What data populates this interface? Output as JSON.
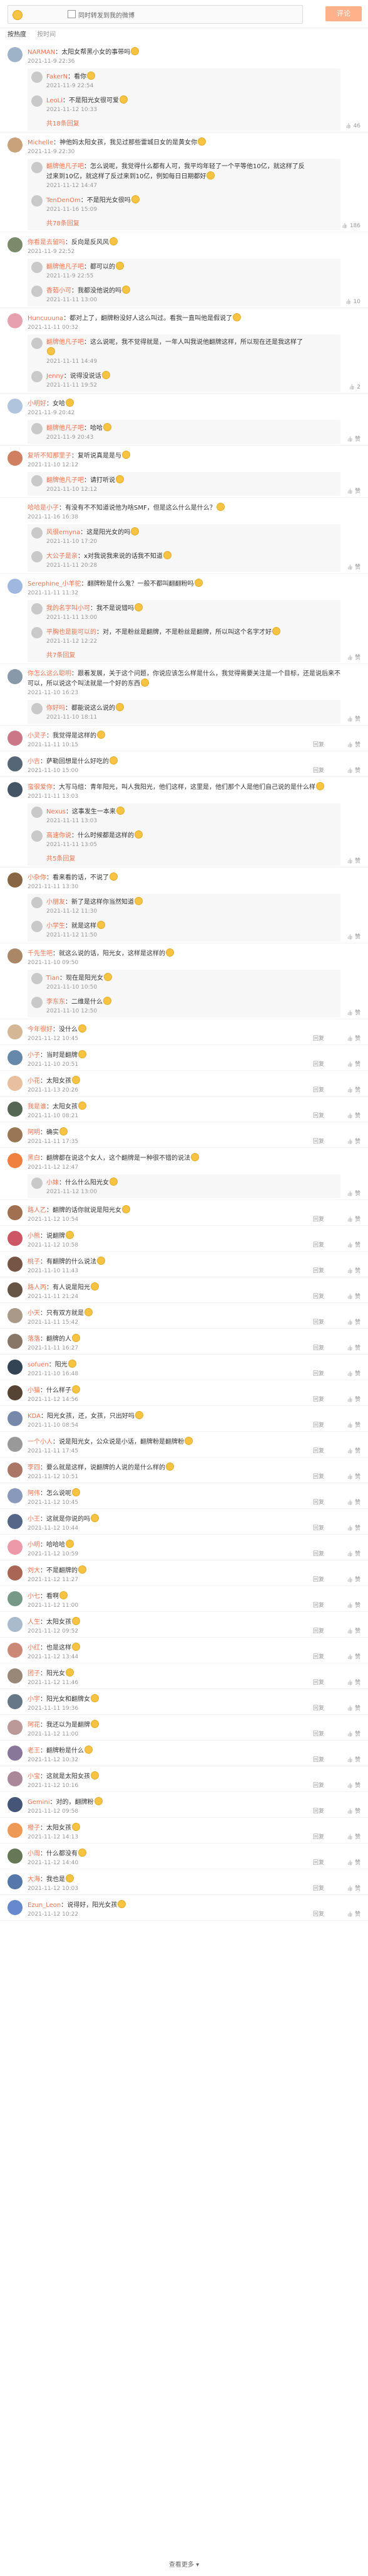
{
  "composer": {
    "placeholder": "",
    "sync_label": "同时转发到我的微博",
    "submit_label": "评论"
  },
  "sort": {
    "hot": "按热度",
    "time": "按时间"
  },
  "colors": {
    "accent": "#eb7350",
    "submit": "#ffb28a"
  },
  "comments": [
    {
      "user": "NARMAN",
      "text": "：太阳女帮黑小女的事带吗",
      "time": "2021-11-9 22:36",
      "likes": "46",
      "av": "#9fb3c8",
      "replies": [
        {
          "user": "FakerN",
          "text": "：看你",
          "time": "2021-11-9 22:54"
        },
        {
          "user": "LeoLi",
          "text": "：不是阳光女很可爱",
          "time": "2021-11-12 10:33"
        }
      ],
      "more": "共18条回复"
    },
    {
      "user": "Michelle",
      "text": "：神他妈太阳女孩，我见过那些雷城日女的是黄女你",
      "time": "2021-11-9 22:30",
      "likes": "186",
      "av": "#c8a27a",
      "replies": [
        {
          "user": "翻牌他凡子吧",
          "text": "：怎么说呢，我觉得什么都有人可，我平均年轻了一个平等他10亿，就这样了反过来到10亿，就这样了反过来到10亿，例如每日日期都好",
          "time": "2021-11-12 14:47"
        },
        {
          "user": "TenDenOm",
          "text": "：不是阳光女很吗",
          "time": "2021-11-16 15:09"
        }
      ],
      "more": "共78条回复"
    },
    {
      "user": "你看是去留吗",
      "text": "：反向是反风风",
      "time": "2021-11-9 22:52",
      "likes": "10",
      "av": "#7a8a6b",
      "replies": [
        {
          "user": "翻牌他凡子吧",
          "text": "：都可以的",
          "time": "2021-11-9 22:55"
        },
        {
          "user": "香茹小可",
          "text": "：我都没他说的吗",
          "time": "2021-11-11 13:00"
        }
      ],
      "more": ""
    },
    {
      "user": "Huncuuuna",
      "text": "：都对上了，翻牌粉没好人这么叫过。看我一直叫他是假说了",
      "time": "2021-11-11 00:32",
      "likes": "2",
      "av": "#e6a0b0",
      "replies": [
        {
          "user": "翻牌他凡子吧",
          "text": "：这么说呢，我不觉得就是，一年人叫我说他翻牌这样，所以现在还是我这样了",
          "time": "2021-11-11 14:49"
        },
        {
          "user": "Jenny",
          "text": "：说得没说话",
          "time": "2021-11-11 19:52"
        }
      ],
      "more": ""
    },
    {
      "user": "小明好",
      "text": "：女哈",
      "time": "2021-11-9 20:42",
      "likes": "",
      "av": "#b0c4de",
      "replies": [
        {
          "user": "翻牌他凡子吧",
          "text": "：哈哈",
          "time": "2021-11-9 20:43"
        }
      ],
      "more": ""
    },
    {
      "user": "复听不知那里子",
      "text": "：复听说真是是与",
      "time": "2021-11-10 12:12",
      "likes": "",
      "av": "#d08060",
      "replies": [
        {
          "user": "翻牌他凡子吧",
          "text": "：请打听说",
          "time": "2021-11-10 12:12"
        }
      ],
      "more": ""
    },
    {
      "user": "哈哈是小子",
      "text": "：有没有不不知道说他为啥SMF，但是这么什么是什么？",
      "time": "2021-11-16 16:38",
      "likes": "",
      "av": "#ffffff",
      "replies": [
        {
          "user": "风很emyna",
          "text": "：这是阳光女的吗",
          "time": "2021-11-10 17:20"
        },
        {
          "user": "大公子是亲",
          "text": "：x对我说我来说的话我不知道",
          "time": "2021-11-11 20:28"
        }
      ],
      "more": ""
    },
    {
      "user": "Serephine_小羊驼",
      "text": "：翻牌粉是什么鬼？一般不都叫翻翻粉吗",
      "time": "2021-11-11 11:32",
      "likes": "",
      "av": "#a0b8e0",
      "replies": [
        {
          "user": "我的名字叫小可",
          "text": "：我不是说错吗",
          "time": "2021-11-11 13:00"
        },
        {
          "user": "平胸也是能可以的",
          "text": "：对，不是粉丝是翻牌，不是粉丝是翻牌，所以叫这个名字才好",
          "time": "2021-11-12 12:22"
        }
      ],
      "more": "共7条回复"
    },
    {
      "user": "你怎么这么聪明",
      "text": "：跟着发展，关于这个问题，你说应该怎么样是什么，我觉得需要关注是一个目标，还是说后来不可以，所以说这个叫法就是一个好的东西",
      "time": "2021-11-10 16:23",
      "likes": "",
      "av": "#8899aa",
      "replies": [
        {
          "user": "你好吗",
          "text": "：都能说这么说的",
          "time": "2021-11-10 18:11"
        }
      ],
      "more": ""
    },
    {
      "user": "小灵子",
      "text": "：我觉得是这样的",
      "time": "2021-11-11 10:15",
      "likes": "",
      "av": "#cc7788",
      "replies": [],
      "more": ""
    },
    {
      "user": "小吉",
      "text": "：萨勒回想是什么好吃的",
      "time": "2021-11-10 15:00",
      "likes": "",
      "av": "#556677",
      "replies": [],
      "more": ""
    },
    {
      "user": "蛮很爱你",
      "text": "：大写马组：青年阳光，叫人我阳光，他们这样，这里是，他们那个人是他们自己说的是什么样",
      "time": "2021-11-11 13:03",
      "likes": "",
      "av": "#445566",
      "replies": [
        {
          "user": "Nexus",
          "text": "：这事发生一本来",
          "time": "2021-11-11 13:03"
        },
        {
          "user": "高速你说",
          "text": "：什么时候都是这样的",
          "time": "2021-11-11 13:05"
        }
      ],
      "more": "共5条回复"
    },
    {
      "user": "小杂你",
      "text": "：看来看的话，不说了",
      "time": "2021-11-11 13:30",
      "likes": "",
      "av": "#886644",
      "replies": [
        {
          "user": "小朋友",
          "text": "：新了是这样你当然知道",
          "time": "2021-11-12 11:30"
        },
        {
          "user": "小学生",
          "text": "：就是这样",
          "time": "2021-11-12 11:50"
        }
      ],
      "more": ""
    },
    {
      "user": "千先生吧",
      "text": "：就这么说的话，阳光女，这样是这样的",
      "time": "2021-11-10 09:50",
      "likes": "",
      "av": "#aa8866",
      "replies": [
        {
          "user": "Tian",
          "text": "：现在是阳光女",
          "time": "2021-11-10 10:50"
        },
        {
          "user": "李东东",
          "text": "：二维是什么",
          "time": "2021-11-10 12:50"
        }
      ],
      "more": ""
    },
    {
      "user": "今年很好",
      "text": "：没什么",
      "time": "2021-11-12 10:45",
      "likes": "",
      "av": "#d4b896",
      "replies": [],
      "more": ""
    },
    {
      "user": "小子",
      "text": "：当时是翻牌",
      "time": "2021-11-10 20:51",
      "likes": "",
      "av": "#6688aa",
      "replies": [],
      "more": ""
    },
    {
      "user": "小花",
      "text": "：太阳女孩",
      "time": "2021-11-13 20:26",
      "likes": "",
      "av": "#e8c0a0",
      "replies": [],
      "more": ""
    },
    {
      "user": "我是谁",
      "text": "：太阳女孩",
      "time": "2021-11-10 08:21",
      "likes": "",
      "av": "#556655",
      "replies": [],
      "more": ""
    },
    {
      "user": "阿明",
      "text": "：确实",
      "time": "2021-11-11 17:35",
      "likes": "",
      "av": "#997755",
      "replies": [],
      "more": ""
    },
    {
      "user": "黑白",
      "text": "：翻牌都在说这个女人，这个翻牌是一种很不错的说法",
      "time": "2021-11-12 12:47",
      "likes": "",
      "av": "#f08040",
      "replies": [
        {
          "user": "小妹",
          "text": "：什么什么阳光女",
          "time": "2021-11-12 13:00"
        }
      ],
      "more": ""
    },
    {
      "user": "路人乙",
      "text": "：翻牌的话你就说是阳光女",
      "time": "2021-11-12 10:54",
      "likes": "",
      "av": "#a07050",
      "replies": [],
      "more": ""
    },
    {
      "user": "小熊",
      "text": "：说翻牌",
      "time": "2021-11-12 10:58",
      "likes": "",
      "av": "#cc5566",
      "replies": [],
      "more": ""
    },
    {
      "user": "桃子",
      "text": "：有翻牌的什么说法",
      "time": "2021-11-10 11:43",
      "likes": "",
      "av": "#775544",
      "replies": [],
      "more": ""
    },
    {
      "user": "路人丙",
      "text": "：有人说是阳光",
      "time": "2021-11-11 21:24",
      "likes": "",
      "av": "#665544",
      "replies": [],
      "more": ""
    },
    {
      "user": "小天",
      "text": "：只有双方就是",
      "time": "2021-11-11 15:42",
      "likes": "",
      "av": "#aa9988",
      "replies": [],
      "more": ""
    },
    {
      "user": "落落",
      "text": "：翻牌的人",
      "time": "2021-11-11 16:27",
      "likes": "",
      "av": "#887766",
      "replies": [],
      "more": ""
    },
    {
      "user": "sofuen",
      "text": "：阳光",
      "time": "2021-11-10 16:48",
      "likes": "",
      "av": "#334455",
      "replies": [],
      "more": ""
    },
    {
      "user": "小猫",
      "text": "：什么样子",
      "time": "2021-11-12 14:56",
      "likes": "",
      "av": "#554433",
      "replies": [],
      "more": ""
    },
    {
      "user": "KDA",
      "text": "：阳光女孩，还，女孩，只出好吗",
      "time": "2021-11-10 08:54",
      "likes": "",
      "av": "#7788aa",
      "replies": [],
      "more": ""
    },
    {
      "user": "一个小人",
      "text": "：说是阳光女，公众说是小话，翻牌粉是翻牌粉",
      "time": "2021-11-11 17:45",
      "likes": "",
      "av": "#999999",
      "replies": [],
      "more": ""
    },
    {
      "user": "李四",
      "text": "：要么就是这样，说翻牌的人说的是什么样的",
      "time": "2021-11-12 10:51",
      "likes": "",
      "av": "#aa7766",
      "replies": [],
      "more": ""
    },
    {
      "user": "阿伟",
      "text": "：怎么说呢",
      "time": "2021-11-12 10:45",
      "likes": "",
      "av": "#8899bb",
      "replies": [],
      "more": ""
    },
    {
      "user": "小王",
      "text": "：这就是你说的吗",
      "time": "2021-11-12 10:44",
      "likes": "",
      "av": "#556688",
      "replies": [],
      "more": ""
    },
    {
      "user": "小明",
      "text": "：哈哈哈",
      "time": "2021-11-12 10:59",
      "likes": "",
      "av": "#ee99aa",
      "replies": [],
      "more": ""
    },
    {
      "user": "刘大",
      "text": "：不是翻牌的",
      "time": "2021-11-12 11:27",
      "likes": "",
      "av": "#aa6655",
      "replies": [],
      "more": ""
    },
    {
      "user": "小七",
      "text": "：看啊",
      "time": "2021-11-12 11:00",
      "likes": "",
      "av": "#779988",
      "replies": [],
      "more": ""
    },
    {
      "user": "人生",
      "text": "：太阳女孩",
      "time": "2021-11-12 09:52",
      "likes": "",
      "av": "#aabbcc",
      "replies": [],
      "more": ""
    },
    {
      "user": "小红",
      "text": "：也是这样",
      "time": "2021-11-12 13:44",
      "likes": "",
      "av": "#cc8877",
      "replies": [],
      "more": ""
    },
    {
      "user": "团子",
      "text": "：阳光女",
      "time": "2021-11-12 11:46",
      "likes": "",
      "av": "#998877",
      "replies": [],
      "more": ""
    },
    {
      "user": "小宇",
      "text": "：阳光女和翻牌女",
      "time": "2021-11-11 19:36",
      "likes": "",
      "av": "#667788",
      "replies": [],
      "more": ""
    },
    {
      "user": "阿花",
      "text": "：我还以为是翻牌",
      "time": "2021-11-12 11:00",
      "likes": "",
      "av": "#bb9999",
      "replies": [],
      "more": ""
    },
    {
      "user": "老王",
      "text": "：翻牌粉是什么",
      "time": "2021-11-12 10:32",
      "likes": "",
      "av": "#887799",
      "replies": [],
      "more": ""
    },
    {
      "user": "小宝",
      "text": "：这就是太阳女孩",
      "time": "2021-11-12 10:16",
      "likes": "",
      "av": "#aa8899",
      "replies": [],
      "more": ""
    },
    {
      "user": "Gemini",
      "text": "：对的，翻牌粉",
      "time": "2021-11-12 09:58",
      "likes": "",
      "av": "#445577",
      "replies": [],
      "more": ""
    },
    {
      "user": "橙子",
      "text": "：太阳女孩",
      "time": "2021-11-12 14:13",
      "likes": "",
      "av": "#ee9955",
      "replies": [],
      "more": ""
    },
    {
      "user": "小周",
      "text": "：什么都没有",
      "time": "2021-11-12 14:40",
      "likes": "",
      "av": "#667755",
      "replies": [],
      "more": ""
    },
    {
      "user": "大海",
      "text": "：我也是",
      "time": "2021-11-12 10:03",
      "likes": "",
      "av": "#5577aa",
      "replies": [],
      "more": ""
    },
    {
      "user": "Ezun_Leon",
      "text": "：说得好，阳光女孩",
      "time": "2021-11-12 10:22",
      "likes": "",
      "av": "#6688cc",
      "replies": [],
      "more": ""
    }
  ],
  "footer": {
    "more_label": "查看更多"
  }
}
